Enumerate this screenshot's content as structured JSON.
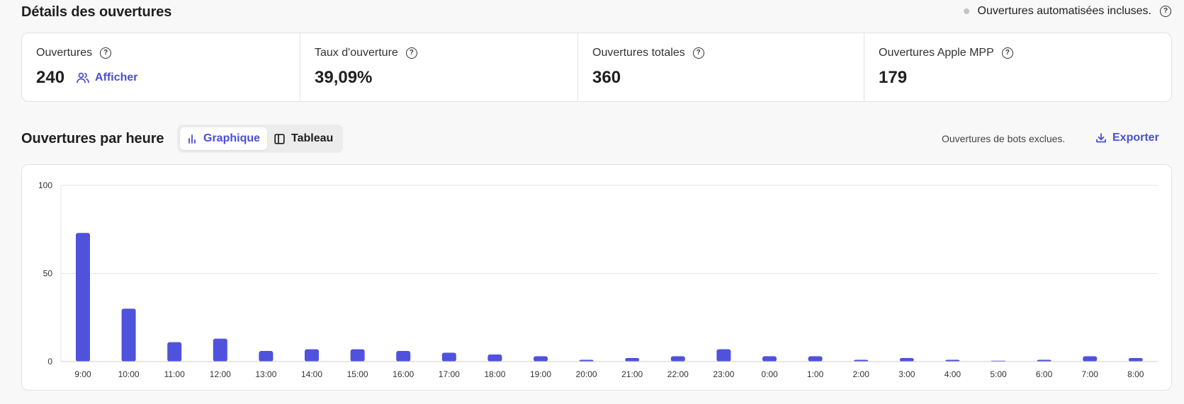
{
  "details": {
    "title": "Détails des ouvertures",
    "auto_note": "Ouvertures automatisées incluses.",
    "stats": [
      {
        "label": "Ouvertures",
        "value": "240",
        "action": "Afficher"
      },
      {
        "label": "Taux d'ouverture",
        "value": "39,09%"
      },
      {
        "label": "Ouvertures totales",
        "value": "360"
      },
      {
        "label": "Ouvertures Apple MPP",
        "value": "179"
      }
    ]
  },
  "hourly": {
    "title": "Ouvertures par heure",
    "view_toggle": {
      "chart_label": "Graphique",
      "table_label": "Tableau",
      "selected": "Graphique"
    },
    "bots_note": "Ouvertures de bots exclues.",
    "export_label": "Exporter"
  },
  "colors": {
    "accent": "#4a4fd4",
    "bar": "#4f52dc",
    "grid": "#e5e5e5"
  },
  "chart_data": {
    "type": "bar",
    "categories": [
      "9:00",
      "10:00",
      "11:00",
      "12:00",
      "13:00",
      "14:00",
      "15:00",
      "16:00",
      "17:00",
      "18:00",
      "19:00",
      "20:00",
      "21:00",
      "22:00",
      "23:00",
      "0:00",
      "1:00",
      "2:00",
      "3:00",
      "4:00",
      "5:00",
      "6:00",
      "7:00",
      "8:00"
    ],
    "values": [
      73,
      30,
      11,
      13,
      6,
      7,
      7,
      6,
      5,
      4,
      3,
      1,
      2,
      3,
      7,
      3,
      3,
      1,
      2,
      1,
      0,
      1,
      3,
      2
    ],
    "yticks": [
      0,
      50,
      100
    ],
    "ylim": [
      0,
      100
    ],
    "grid": true,
    "legend": "none"
  }
}
